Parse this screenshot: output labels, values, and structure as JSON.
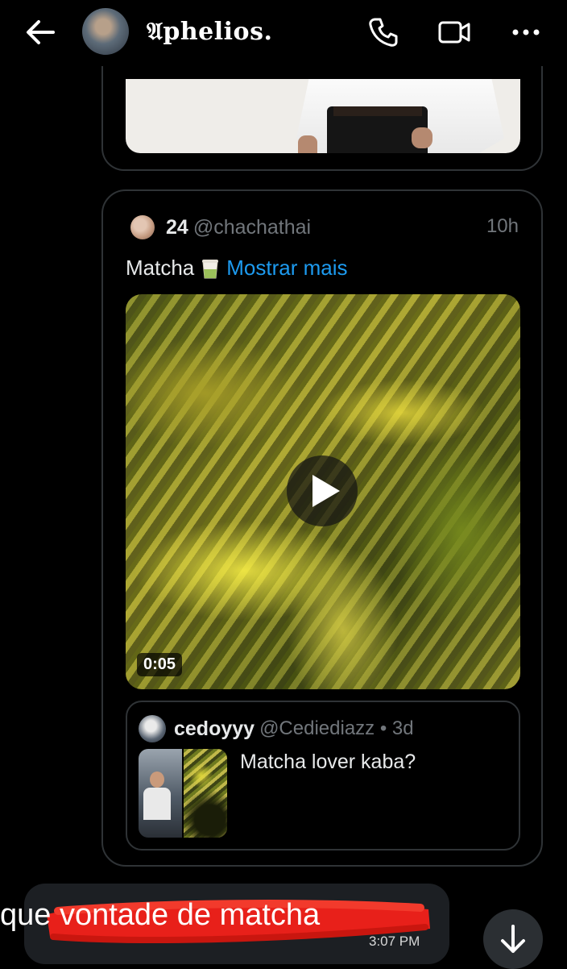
{
  "header": {
    "chat_name": "𝔄phelios.",
    "icons": [
      "back-arrow-icon",
      "phone-icon",
      "video-call-icon",
      "more-icon"
    ]
  },
  "post": {
    "author_name": "24",
    "author_handle": "@chachathai",
    "time": "10h",
    "text": "Matcha",
    "more_link": "Mostrar mais",
    "video_duration": "0:05",
    "quote": {
      "name": "cedoyyy",
      "handle_time": "@Cediediazz • 3d",
      "text": "Matcha lover kaba?"
    }
  },
  "message": {
    "prefix": "que",
    "text": "vontade de matcha",
    "time": "3:07 PM"
  },
  "colors": {
    "background": "#000000",
    "link": "#1d9bf0",
    "scribble": "#e8201a",
    "bubble": "#1c1f23"
  }
}
